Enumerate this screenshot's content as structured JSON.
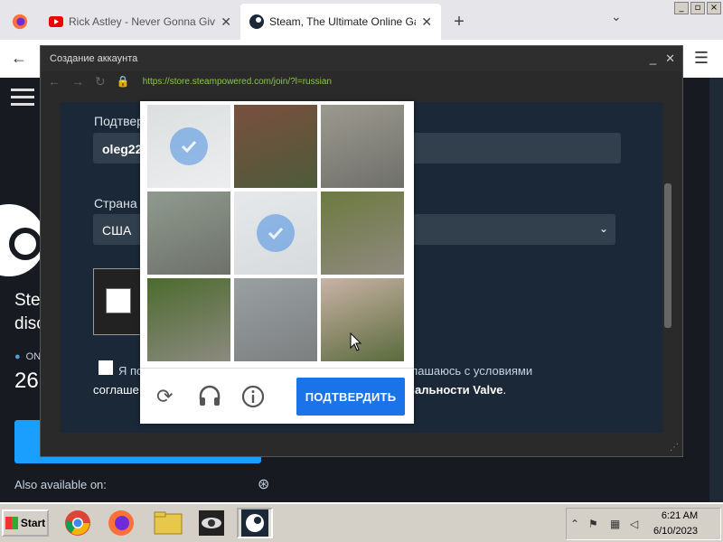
{
  "browser": {
    "tabs": [
      {
        "title": "Rick Astley - Never Gonna Give You",
        "icon": "youtube-icon"
      },
      {
        "title": "Steam, The Ultimate Online Game Pla",
        "icon": "steam-icon"
      }
    ],
    "new_tab_label": "+",
    "tab_list_label": "⌄",
    "win_controls": [
      "_",
      "▫",
      "×"
    ]
  },
  "page": {
    "promo_line1": "Stea",
    "promo_line2": "disc",
    "online_label": "ON",
    "count_label": "26",
    "also_available": "Also available on:"
  },
  "popup": {
    "title": "Создание аккаунта",
    "url": "https://store.steampowered.com/join/?l=russian",
    "form": {
      "confirm_label": "Подтвер",
      "confirm_value": "oleg22",
      "country_label": "Страна",
      "country_value": "США",
      "terms_line1_a": "Я по",
      "terms_line1_b": "оглашаюсь с условиями",
      "terms_line2_a": "соглаше",
      "terms_line2_b": "циальности Valve",
      "terms_line2_end": "."
    }
  },
  "captcha": {
    "tiles": [
      {
        "selected": true,
        "colors": [
          "#9aa3a6",
          "#c9cdd0"
        ]
      },
      {
        "selected": false,
        "colors": [
          "#7a4f3e",
          "#4d5b3b"
        ]
      },
      {
        "selected": false,
        "colors": [
          "#9c9a8f",
          "#6f6f6a"
        ]
      },
      {
        "selected": false,
        "colors": [
          "#8f9a8e",
          "#6e716a"
        ]
      },
      {
        "selected": true,
        "colors": [
          "#b5c0c8",
          "#8c969c"
        ]
      },
      {
        "selected": false,
        "colors": [
          "#6d7a3f",
          "#8f8a80"
        ]
      },
      {
        "selected": false,
        "colors": [
          "#4c6b2d",
          "#8c8a80"
        ]
      },
      {
        "selected": false,
        "colors": [
          "#9aa0a2",
          "#7c7f80"
        ]
      },
      {
        "selected": false,
        "colors": [
          "#c9b3a6",
          "#5a6a3c"
        ]
      }
    ],
    "verify_label": "ПОДТВЕРДИТЬ",
    "footer_icons": [
      "refresh-icon",
      "headphones-icon",
      "info-icon"
    ]
  },
  "taskbar": {
    "start_label": "Start",
    "apps": [
      "chrome-icon",
      "firefox-icon",
      "folder-icon",
      "eye-icon",
      "steam-icon"
    ],
    "time": "6:21 AM",
    "date": "6/10/2023"
  }
}
